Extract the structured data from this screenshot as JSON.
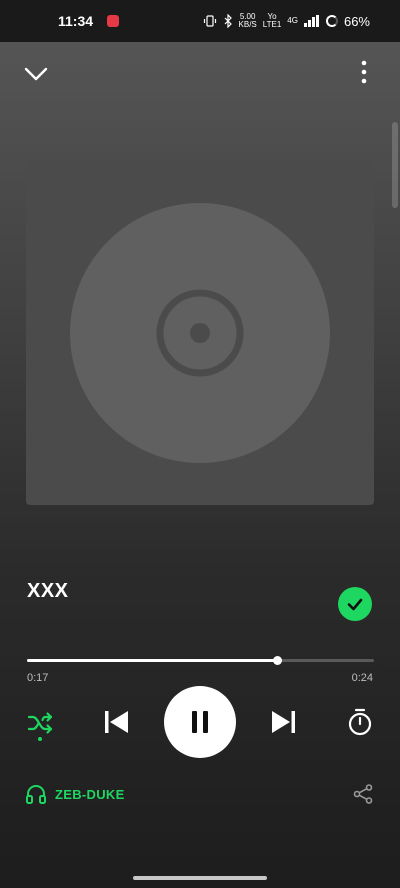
{
  "status_bar": {
    "time": "11:34",
    "network_speed_value": "5.00",
    "network_speed_unit": "KB/S",
    "volte_top": "Yo",
    "volte_bottom": "LTE1",
    "signal_label": "4G",
    "battery": "66%"
  },
  "player": {
    "track_title": "XXX",
    "progress_fraction": 0.72,
    "elapsed": "0:17",
    "total": "0:24",
    "device": "ZEB-DUKE",
    "liked": true,
    "playing": true
  },
  "colors": {
    "accent": "#1ed760",
    "album_bg": "#4b4b4b",
    "disc": "#606060",
    "disc_hole": "#4b4b4b"
  },
  "icons": {
    "collapse": "chevron-down-icon",
    "menu": "more-vertical-icon",
    "liked": "check-icon",
    "shuffle": "shuffle-icon",
    "previous": "skip-previous-icon",
    "pause": "pause-icon",
    "next": "skip-next-icon",
    "timer": "sleep-timer-icon",
    "device": "headphones-icon",
    "share": "share-icon"
  }
}
